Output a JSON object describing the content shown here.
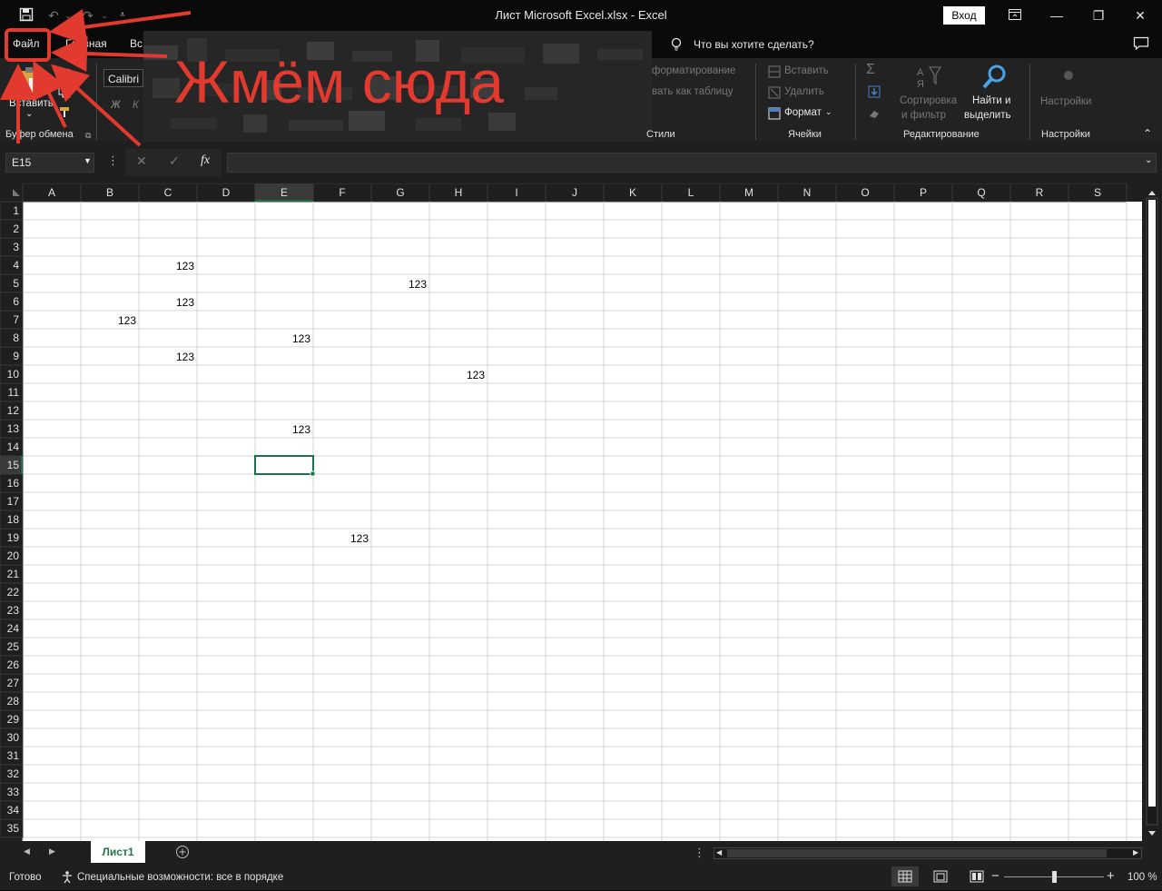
{
  "titlebar": {
    "document_title": "Лист Microsoft Excel.xlsx  -  Excel",
    "signin_label": "Вход",
    "icons": [
      "save-icon",
      "undo-icon",
      "redo-icon",
      "customize-quick-access-icon",
      "ribbon-display-options-icon",
      "minimize-icon",
      "restore-icon",
      "close-icon"
    ]
  },
  "tabs": {
    "file": "Файл",
    "home": "Главная",
    "insert_partial": "Вс",
    "tell_me": "Что вы хотите сделать?"
  },
  "ribbon": {
    "clipboard": {
      "paste": "Вставить",
      "group_label": "Буфер обмена"
    },
    "font": {
      "name": "Calibri",
      "bold": "Ж",
      "italic": "К"
    },
    "styles": {
      "conditional": "форматирование",
      "as_table": "вать как таблицу",
      "group_label": "Стили"
    },
    "cells": {
      "insert": "Вставить",
      "delete": "Удалить",
      "format": "Формат",
      "group_label": "Ячейки"
    },
    "editing": {
      "sort_line1": "Сортировка",
      "sort_line2": "и фильтр",
      "find_line1": "Найти и",
      "find_line2": "выделить",
      "group_label": "Редактирование"
    },
    "settings": {
      "button": "Настройки",
      "group_label": "Настройки"
    }
  },
  "formula_bar": {
    "name_box": "E15",
    "fx": "fx",
    "value": ""
  },
  "sheet": {
    "columns": [
      "A",
      "B",
      "C",
      "D",
      "E",
      "F",
      "G",
      "H",
      "I",
      "J",
      "K",
      "L",
      "M",
      "N",
      "O",
      "P",
      "Q",
      "R",
      "S"
    ],
    "row_count": 35,
    "selected_cell": "E15",
    "cells": [
      {
        "ref": "C4",
        "value": "123"
      },
      {
        "ref": "G5",
        "value": "123"
      },
      {
        "ref": "C6",
        "value": "123"
      },
      {
        "ref": "B7",
        "value": "123"
      },
      {
        "ref": "E8",
        "value": "123"
      },
      {
        "ref": "C9",
        "value": "123"
      },
      {
        "ref": "H10",
        "value": "123"
      },
      {
        "ref": "E13",
        "value": "123"
      },
      {
        "ref": "F19",
        "value": "123"
      }
    ]
  },
  "sheet_tabs": {
    "active": "Лист1"
  },
  "status": {
    "ready": "Готово",
    "accessibility": "Специальные возможности: все в порядке",
    "zoom": "100 %",
    "zoom_fraction": 0.5
  },
  "annotation": {
    "text": "Жмём сюда",
    "color": "#e23a2e"
  },
  "colors": {
    "accent": "#217346",
    "selection": "#1e7145",
    "annotation": "#e23a2e"
  }
}
